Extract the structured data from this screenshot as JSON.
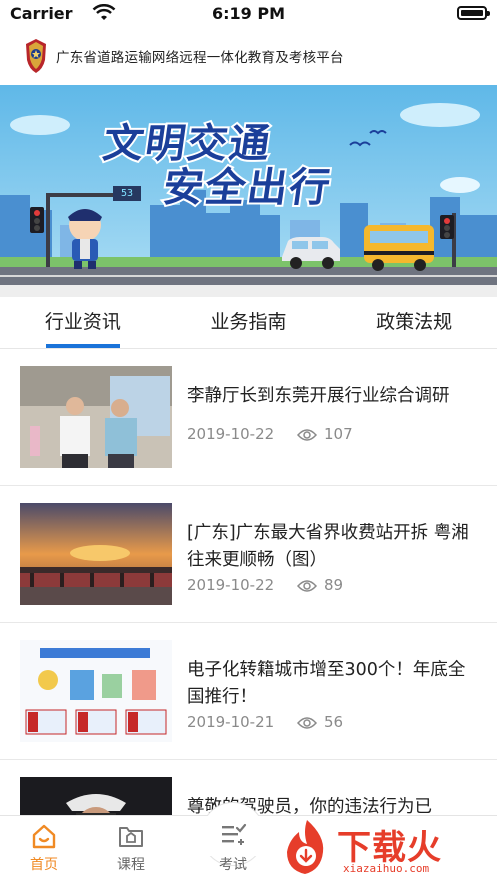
{
  "status_bar": {
    "carrier": "Carrier",
    "time": "6:19 PM"
  },
  "header": {
    "title": "广东省道路运输网络远程一体化教育及考核平台"
  },
  "banner": {
    "headline_1": "文明交通",
    "headline_2": "安全出行",
    "sign_value": "53",
    "bus_label": "School Bus"
  },
  "tabs": [
    {
      "label": "行业资讯",
      "active": true
    },
    {
      "label": "业务指南",
      "active": false
    },
    {
      "label": "政策法规",
      "active": false
    }
  ],
  "news": [
    {
      "title": "李静厅长到东莞开展行业综合调研",
      "date": "2019-10-22",
      "views": "107"
    },
    {
      "title": "[广东]广东最大省界收费站开拆 粤湘往来更顺畅（图）",
      "date": "2019-10-22",
      "views": "89"
    },
    {
      "title": "电子化转籍城市增至300个！年底全国推行！",
      "date": "2019-10-21",
      "views": "56"
    },
    {
      "title": "尊敬的驾驶员，你的违法行为已",
      "date": "",
      "views": ""
    }
  ],
  "tabbar": [
    {
      "label": "首页",
      "icon": "home-icon",
      "active": true
    },
    {
      "label": "课程",
      "icon": "course-icon",
      "active": false
    },
    {
      "label": "考试",
      "icon": "exam-icon",
      "active": false
    }
  ],
  "watermark": {
    "text": "下载火",
    "url": "xiazaihuo.com"
  },
  "colors": {
    "accent": "#1a73d9",
    "active_tab": "#f08a24",
    "watermark": "#e63d2a"
  }
}
